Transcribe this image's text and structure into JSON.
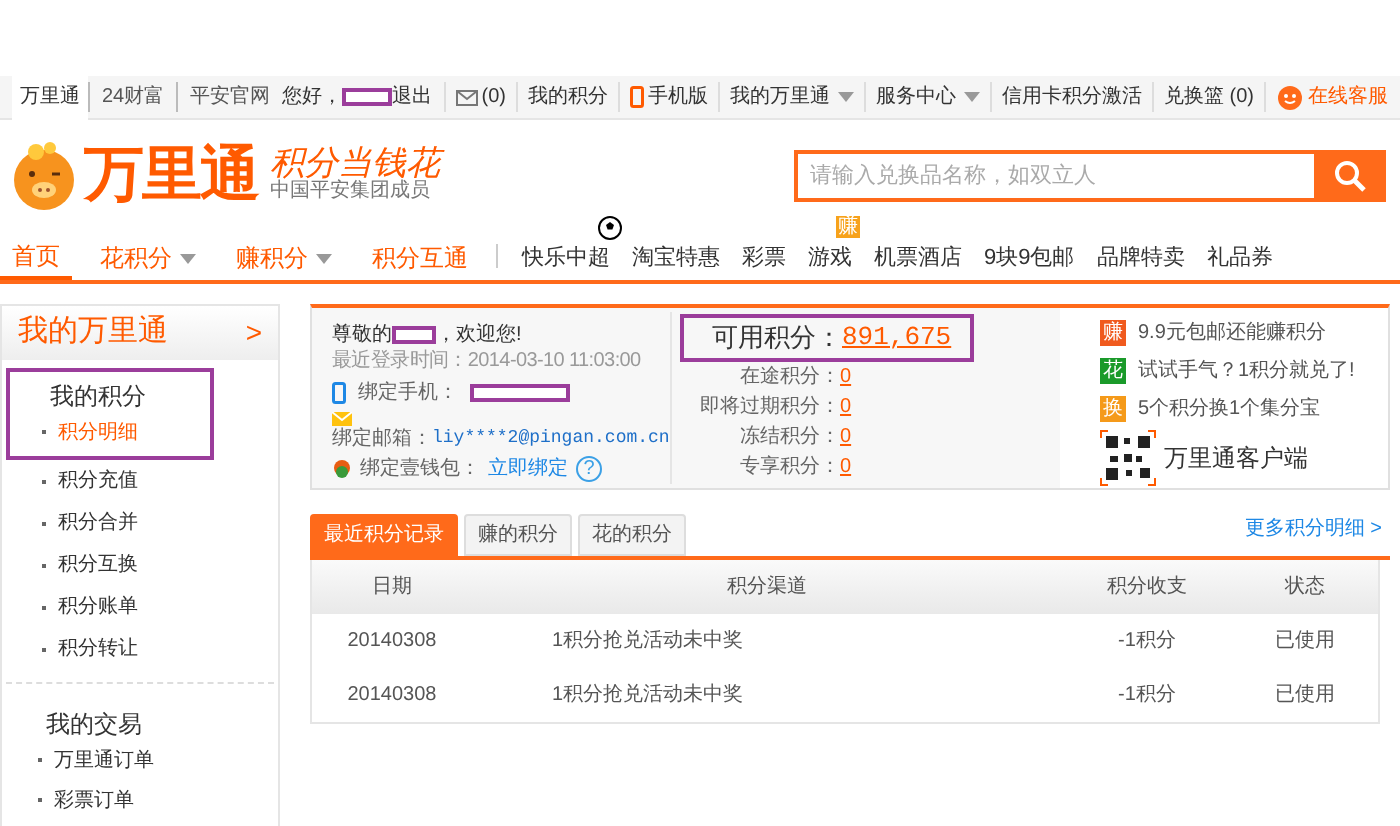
{
  "top_bar": {
    "site_links": [
      {
        "label": "万里通",
        "selected": true
      },
      {
        "label": "24财富",
        "selected": false
      },
      {
        "label": "平安官网",
        "selected": false
      }
    ],
    "greeting": "您好，",
    "logout": "退出",
    "mail_count": "(0)",
    "my_points": "我的积分",
    "mobile": "手机版",
    "my_account": "我的万里通",
    "service": "服务中心",
    "card_activate": "信用卡积分激活",
    "basket": "兑换篮 (0)",
    "support": "在线客服"
  },
  "header": {
    "logo": "万里通",
    "slogan": "积分当钱花",
    "subtitle": "中国平安集团成员",
    "search": {
      "placeholder": "请输入兑换品名称，如双立人"
    }
  },
  "nav": {
    "main": [
      {
        "label": "首页",
        "selected": true,
        "dropdown": false
      },
      {
        "label": "花积分",
        "selected": false,
        "dropdown": true
      },
      {
        "label": "赚积分",
        "selected": false,
        "dropdown": true
      },
      {
        "label": "积分互通",
        "selected": false,
        "dropdown": false
      }
    ],
    "channels": [
      {
        "label": "快乐中超",
        "kind": "ball"
      },
      {
        "label": "淘宝特惠",
        "kind": "plain"
      },
      {
        "label": "彩票",
        "kind": "plain"
      },
      {
        "label": "游戏",
        "kind": "badge",
        "badge": "赚"
      },
      {
        "label": "机票酒店",
        "kind": "plain"
      },
      {
        "label": "9块9包邮",
        "kind": "plain"
      },
      {
        "label": "品牌特卖",
        "kind": "plain"
      },
      {
        "label": "礼品券",
        "kind": "plain"
      }
    ]
  },
  "sidebar": {
    "title": "我的万里通",
    "arrow": ">",
    "groups": [
      {
        "title": "我的积分",
        "items": [
          {
            "label": "积分明细",
            "selected": true
          },
          {
            "label": "积分充值",
            "selected": false
          },
          {
            "label": "积分合并",
            "selected": false
          },
          {
            "label": "积分互换",
            "selected": false
          },
          {
            "label": "积分账单",
            "selected": false
          },
          {
            "label": "积分转让",
            "selected": false
          }
        ]
      },
      {
        "title": "我的交易",
        "items": [
          {
            "label": "万里通订单",
            "selected": false
          },
          {
            "label": "彩票订单",
            "selected": false
          }
        ]
      }
    ]
  },
  "account": {
    "welcome_prefix": "尊敬的",
    "welcome_suffix": "，欢迎您!",
    "last_login": "最近登录时间：2014-03-10 11:03:00",
    "phone_label": "绑定手机：",
    "email_label": "绑定邮箱：",
    "email": "liy****2@pingan.com.cn",
    "wallet_label": "绑定壹钱包：",
    "wallet_link": "立即绑定",
    "help": "?"
  },
  "points": {
    "label": "可用积分：",
    "value": "891,675",
    "rows": [
      {
        "label": "在途积分：",
        "value": "0"
      },
      {
        "label": "即将过期积分：",
        "value": "0"
      },
      {
        "label": "冻结积分：",
        "value": "0"
      },
      {
        "label": "专享积分：",
        "value": "0"
      }
    ]
  },
  "promos": [
    {
      "badge": "赚",
      "color": "#f05a1e",
      "text": "9.9元包邮还能赚积分"
    },
    {
      "badge": "花",
      "color": "#1a9a2a",
      "text": "试试手气？1积分就兑了!"
    },
    {
      "badge": "换",
      "color": "#f59a1a",
      "text": "5个积分换1个集分宝"
    }
  ],
  "app": {
    "label": "万里通客户端"
  },
  "records": {
    "tabs": [
      {
        "label": "最近积分记录",
        "selected": true
      },
      {
        "label": "赚的积分",
        "selected": false
      },
      {
        "label": "花的积分",
        "selected": false
      }
    ],
    "more": "更多积分明细 >",
    "columns": [
      "日期",
      "积分渠道",
      "积分收支",
      "状态"
    ],
    "rows": [
      [
        "20140308",
        "1积分抢兑活动未中奖",
        "-1积分",
        "已使用"
      ],
      [
        "20140308",
        "1积分抢兑活动未中奖",
        "-1积分",
        "已使用"
      ]
    ]
  }
}
